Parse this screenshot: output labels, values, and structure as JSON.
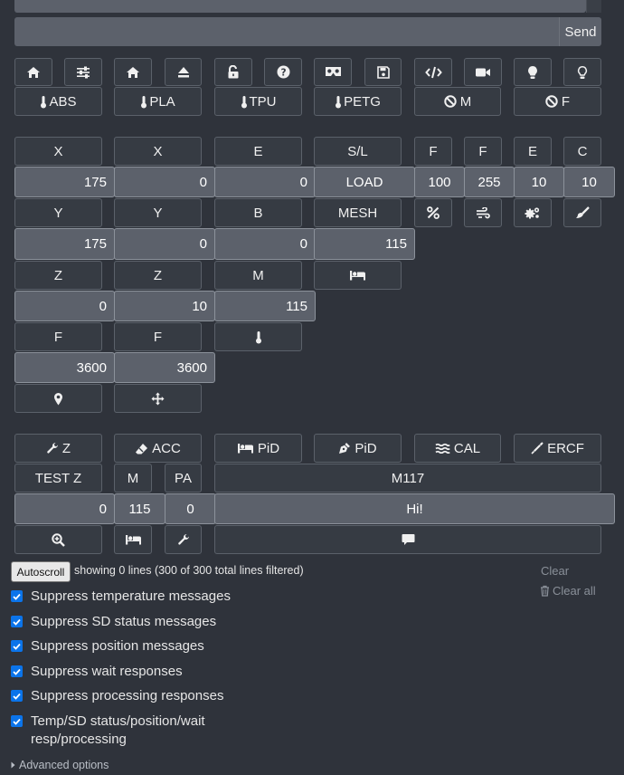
{
  "command": {
    "input_value": "",
    "send_label": "Send"
  },
  "toolbar_icons": [
    {
      "name": "home-icon"
    },
    {
      "name": "sliders-icon"
    },
    {
      "name": "home-icon"
    },
    {
      "name": "eject-icon"
    },
    {
      "name": "unlock-icon"
    },
    {
      "name": "question-icon"
    },
    {
      "name": "vr-cardboard-icon"
    },
    {
      "name": "save-icon"
    },
    {
      "name": "code-icon"
    },
    {
      "name": "video-icon"
    },
    {
      "name": "lightbulb-icon"
    },
    {
      "name": "lightbulb-outline-icon"
    }
  ],
  "presets": [
    {
      "label": "ABS"
    },
    {
      "label": "PLA"
    },
    {
      "label": "TPU"
    },
    {
      "label": "PETG"
    },
    {
      "label": "M"
    },
    {
      "label": "F"
    }
  ],
  "move": {
    "x_label": "X",
    "x_value": "175",
    "x2_label": "X",
    "x2_value": "0",
    "e_label": "E",
    "e_value": "0",
    "sl_label": "S/L",
    "load_label": "LOAD",
    "f1_label": "F",
    "f1_value": "100",
    "f2_label": "F",
    "f2_value": "255",
    "e2_label": "E",
    "e2_value": "10",
    "c_label": "C",
    "c_value": "10",
    "y_label": "Y",
    "y_value": "175",
    "y2_label": "Y",
    "y2_value": "0",
    "b_label": "B",
    "b_value": "0",
    "mesh_label": "MESH",
    "mesh_value": "115",
    "z_label": "Z",
    "z_value": "0",
    "z2_label": "Z",
    "z2_value": "10",
    "m_label": "M",
    "m_value": "115",
    "feed_label": "F",
    "feed_value": "3600",
    "feed2_label": "F",
    "feed2_value": "3600"
  },
  "calibration": {
    "z_label": "Z",
    "acc_label": "ACC",
    "pid_bed_label": "PiD",
    "pid_hotend_label": "PiD",
    "cal_label": "CAL",
    "ercf_label": "ERCF",
    "testz_label": "TEST Z",
    "m_label": "M",
    "pa_label": "PA",
    "m117_label": "M117",
    "testz_value": "0",
    "m_value": "115",
    "pa_value": "0",
    "m117_value": "Hi!"
  },
  "terminal": {
    "autoscroll_label": "Autoscroll",
    "status": "showing 0 lines (300 of 300 total lines filtered)",
    "clear_label": "Clear",
    "clear_all_label": "Clear all",
    "filters": [
      {
        "label": "Suppress temperature messages",
        "checked": true
      },
      {
        "label": "Suppress SD status messages",
        "checked": true
      },
      {
        "label": "Suppress position messages",
        "checked": true
      },
      {
        "label": "Suppress wait responses",
        "checked": true
      },
      {
        "label": "Suppress processing responses",
        "checked": true
      },
      {
        "label": "Temp/SD status/position/wait resp/processing",
        "checked": true
      }
    ],
    "advanced_label": "Advanced options"
  },
  "colors": {
    "background": "#2f333b",
    "button": "#363b43",
    "input": "#5c616b",
    "checkbox": "#0b74ea"
  }
}
